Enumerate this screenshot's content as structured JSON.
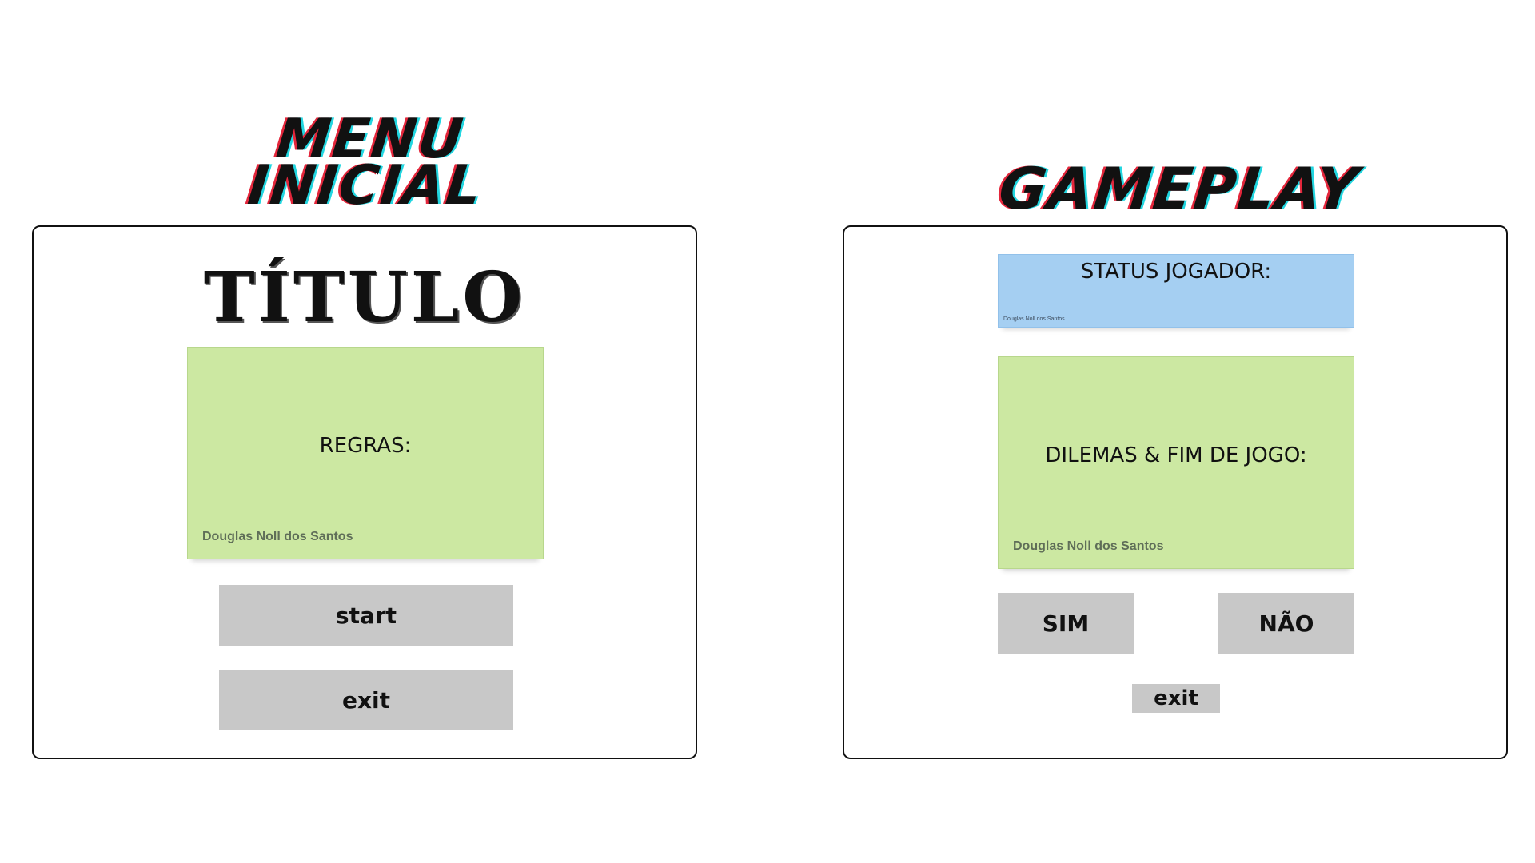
{
  "menu_section": {
    "heading_line1": "MENU",
    "heading_line2": "INICIAL",
    "title": "TÍTULO",
    "rules_label": "REGRAS:",
    "author": "Douglas Noll dos Santos",
    "start_button": "start",
    "exit_button": "exit"
  },
  "gameplay_section": {
    "heading": "GAMEPLAY",
    "status_label": "STATUS JOGADOR:",
    "status_author": "Douglas Noll dos Santos",
    "dilemmas_label": "DILEMAS & FIM DE JOGO:",
    "dilemmas_author": "Douglas Noll dos Santos",
    "yes_button": "SIM",
    "no_button": "NÃO",
    "exit_button": "exit"
  },
  "colors": {
    "green_note": "#cce8a2",
    "blue_note": "#a5cff2",
    "button_gray": "#c8c8c8",
    "heading_red": "#e3263b",
    "heading_cyan": "#22d6e0"
  }
}
